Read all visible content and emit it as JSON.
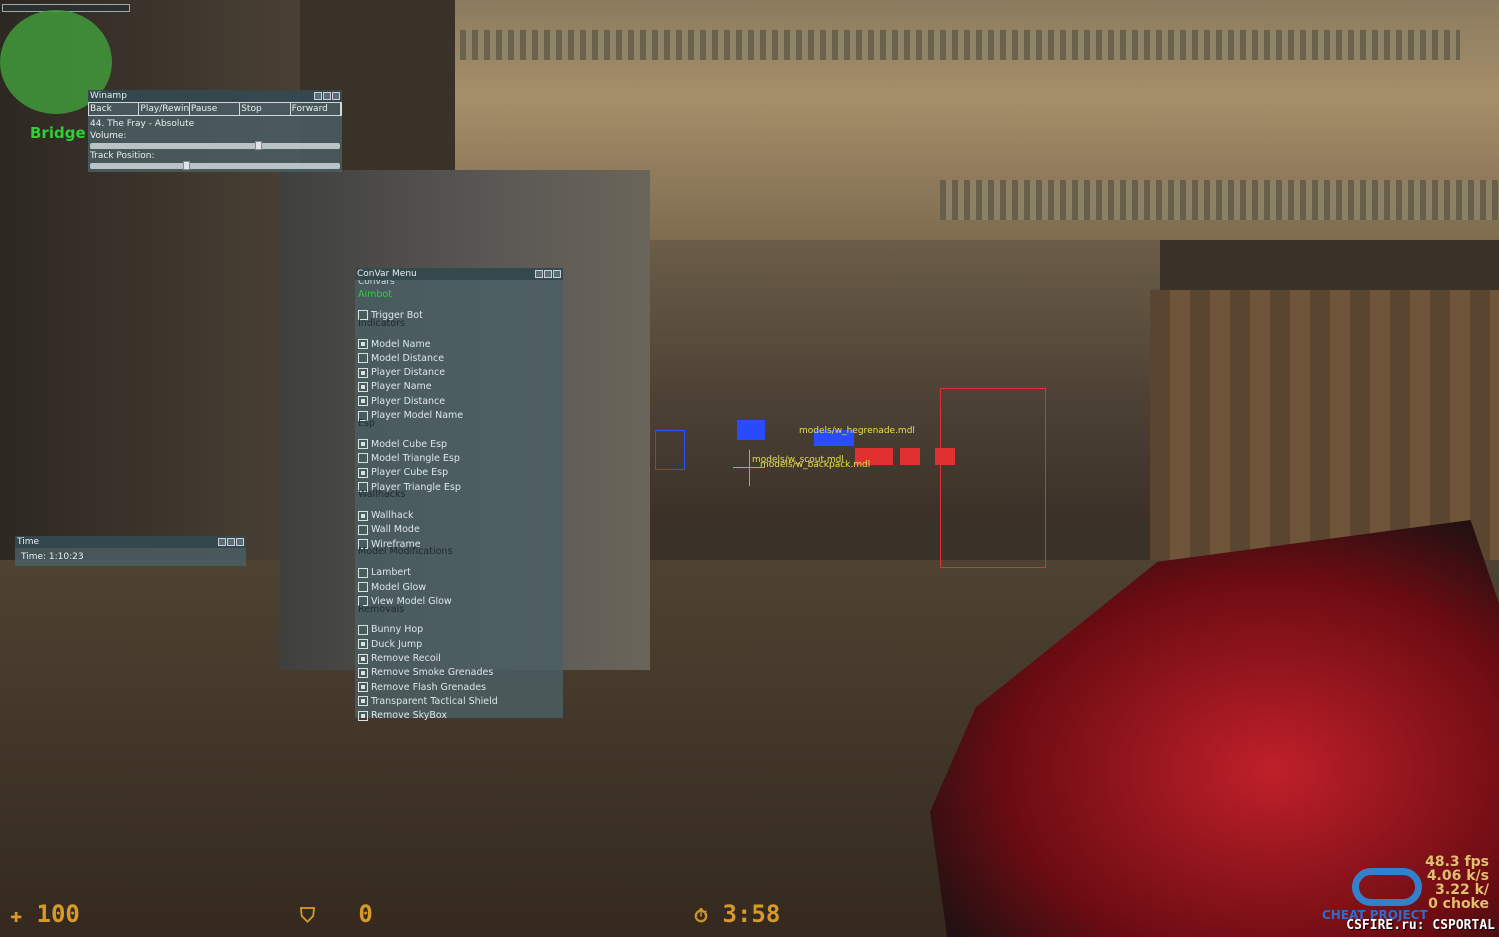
{
  "map_name": "Bridge",
  "winamp": {
    "title": "Winamp",
    "buttons": [
      "Back",
      "Play/Rewind",
      "Pause",
      "Stop",
      "Forward"
    ],
    "track": "44. The Fray - Absolute",
    "volume_label": "Volume:",
    "volume": 0.66,
    "position_label": "Track Position:",
    "position": 0.37
  },
  "time_window": {
    "title": "Time",
    "value": "Time: 1:10:23"
  },
  "menu": {
    "title": "ConVar Menu",
    "header": "Convars",
    "sections": [
      {
        "label": "Aimbot",
        "items": [
          {
            "label": "Trigger Bot",
            "checked": false
          }
        ]
      },
      {
        "label": "Indicators",
        "items": [
          {
            "label": "Model Name",
            "checked": true
          },
          {
            "label": "Model Distance",
            "checked": false
          },
          {
            "label": "Player Distance",
            "checked": true
          },
          {
            "label": "Player Name",
            "checked": true
          },
          {
            "label": "Player Distance",
            "checked": true
          },
          {
            "label": "Player Model Name",
            "checked": false
          }
        ]
      },
      {
        "label": "Esp",
        "items": [
          {
            "label": "Model Cube Esp",
            "checked": true
          },
          {
            "label": "Model Triangle Esp",
            "checked": false
          },
          {
            "label": "Player Cube Esp",
            "checked": true
          },
          {
            "label": "Player Triangle Esp",
            "checked": false
          }
        ]
      },
      {
        "label": "Wallhacks",
        "items": [
          {
            "label": "Wallhack",
            "checked": true
          },
          {
            "label": "Wall Mode",
            "checked": false
          },
          {
            "label": "Wireframe",
            "checked": false
          }
        ]
      },
      {
        "label": "Model Modifications",
        "items": [
          {
            "label": "Lambert",
            "checked": false
          },
          {
            "label": "Model Glow",
            "checked": false
          },
          {
            "label": "View Model Glow",
            "checked": false
          }
        ]
      },
      {
        "label": "Removals",
        "items": [
          {
            "label": "Bunny Hop",
            "checked": false
          },
          {
            "label": "Duck Jump",
            "checked": true
          },
          {
            "label": "Remove Recoil",
            "checked": true
          },
          {
            "label": "Remove Smoke Grenades",
            "checked": true
          },
          {
            "label": "Remove Flash Grenades",
            "checked": true
          },
          {
            "label": "Transparent Tactical Shield",
            "checked": true
          },
          {
            "label": "Remove SkyBox",
            "checked": true
          }
        ]
      }
    ]
  },
  "esp_labels": [
    "models/w_hegrenade.mdl",
    "models/w_scout.mdl",
    "models/w_backpack.mdl"
  ],
  "hud": {
    "health": "100",
    "armor": "0",
    "timer": "3:58",
    "icons": [
      "health-cross-icon",
      "armor-shield-icon",
      "timer-stopwatch-icon"
    ]
  },
  "netgraph": {
    "fps": "48.3 fps",
    "line2": "4.06 k/s",
    "line3": "3.22 k/",
    "line4": "0 choke"
  },
  "watermark": {
    "logo": "CHEAT PROJECT",
    "text": "CSFIRE.ru: CSPORTAL"
  },
  "colors": {
    "aimbot_label": "#2fcf35",
    "hud": "#d79a2a",
    "esp_label": "#e6e04a"
  }
}
